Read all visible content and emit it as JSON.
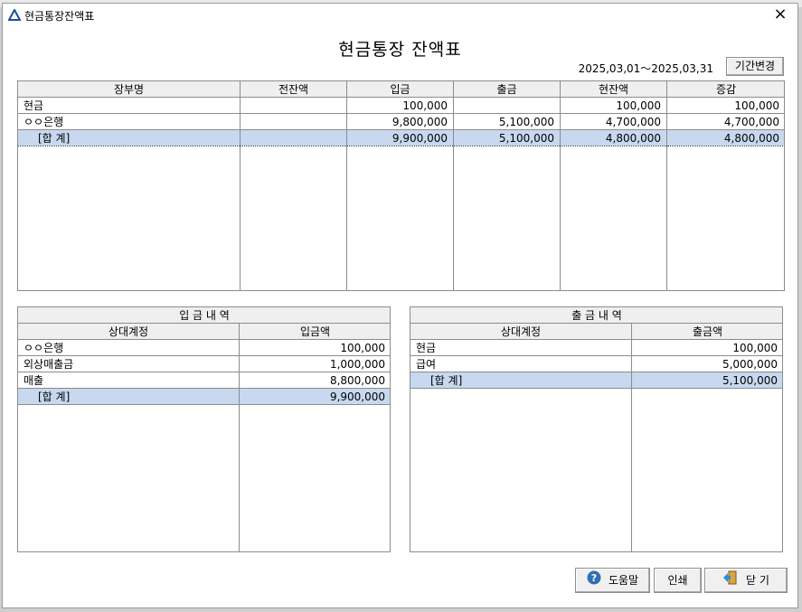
{
  "window": {
    "title": "현금통장잔액표",
    "close_glyph": "×"
  },
  "heading": "현금통장 잔액표",
  "period": {
    "text": "2025,03,01～2025,03,31",
    "change_label": "기간변경"
  },
  "balance": {
    "headers": [
      "장부명",
      "전잔액",
      "입금",
      "출금",
      "현잔액",
      "증감"
    ],
    "rows": [
      {
        "name": "현금",
        "prev": "",
        "in": "100,000",
        "out": "",
        "curr": "100,000",
        "diff": "100,000"
      },
      {
        "name": "ㅇㅇ은행",
        "prev": "",
        "in": "9,800,000",
        "out": "5,100,000",
        "curr": "4,700,000",
        "diff": "4,700,000"
      }
    ],
    "total": {
      "name": "[합  계]",
      "prev": "",
      "in": "9,900,000",
      "out": "5,100,000",
      "curr": "4,800,000",
      "diff": "4,800,000"
    }
  },
  "deposits": {
    "title": "입 금 내 역",
    "headers": [
      "상대계정",
      "입금액"
    ],
    "rows": [
      {
        "account": "ㅇㅇ은행",
        "amount": "100,000"
      },
      {
        "account": "외상매출금",
        "amount": "1,000,000"
      },
      {
        "account": "매출",
        "amount": "8,800,000"
      }
    ],
    "total": {
      "account": "[합  계]",
      "amount": "9,900,000"
    }
  },
  "withdrawals": {
    "title": "출 금 내 역",
    "headers": [
      "상대계정",
      "출금액"
    ],
    "rows": [
      {
        "account": "현금",
        "amount": "100,000"
      },
      {
        "account": "급여",
        "amount": "5,000,000"
      }
    ],
    "total": {
      "account": "[합  계]",
      "amount": "5,100,000"
    }
  },
  "buttons": {
    "help": "도움말",
    "print": "인쇄",
    "close": "닫 기"
  },
  "icons": {
    "window": "app-triangle-icon",
    "help": "question-circle-icon",
    "close": "exit-door-icon"
  },
  "colors": {
    "total_row": "#c7d8ef",
    "header_bg": "#efefef",
    "help_icon": "#2f6fb3"
  }
}
